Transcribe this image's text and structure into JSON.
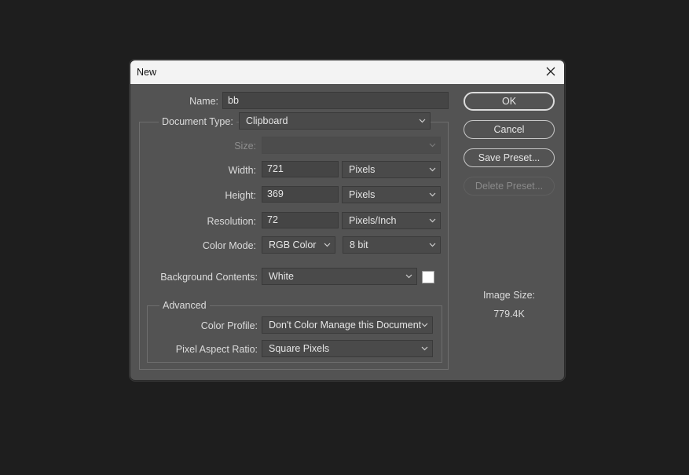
{
  "dialog": {
    "title": "New",
    "name_label": "Name:",
    "name_value": "bb",
    "document_type_label": "Document Type:",
    "document_type_value": "Clipboard",
    "size_label": "Size:",
    "size_value": "",
    "width_label": "Width:",
    "width_value": "721",
    "width_unit": "Pixels",
    "height_label": "Height:",
    "height_value": "369",
    "height_unit": "Pixels",
    "resolution_label": "Resolution:",
    "resolution_value": "72",
    "resolution_unit": "Pixels/Inch",
    "color_mode_label": "Color Mode:",
    "color_mode_value": "RGB Color",
    "bit_depth_value": "8 bit",
    "background_label": "Background Contents:",
    "background_value": "White",
    "background_swatch_color": "#ffffff",
    "advanced_label": "Advanced",
    "color_profile_label": "Color Profile:",
    "color_profile_value": "Don't Color Manage this Document",
    "pixel_aspect_label": "Pixel Aspect Ratio:",
    "pixel_aspect_value": "Square Pixels"
  },
  "buttons": {
    "ok": "OK",
    "cancel": "Cancel",
    "save_preset": "Save Preset...",
    "delete_preset": "Delete Preset..."
  },
  "image_size": {
    "label": "Image Size:",
    "value": "779.4K"
  },
  "icons": {
    "close": "close-icon",
    "dropdown": "chevron-down-icon"
  }
}
